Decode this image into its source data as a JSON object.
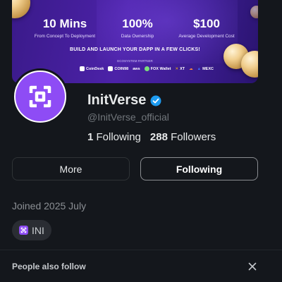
{
  "banner": {
    "stats": [
      {
        "value": "10 Mins",
        "caption": "From Concept To Deployment"
      },
      {
        "value": "100%",
        "caption": "Data Ownership"
      },
      {
        "value": "$100",
        "caption": "Average Development Cost"
      }
    ],
    "tagline": "BUILD AND LAUNCH YOUR DAPP IN A FEW CLICKS!",
    "partner_label": "ECOSYSTEM PARTNER",
    "partners": [
      "CoinDesk",
      "COIN98",
      "aws",
      "FOX Wallet",
      "XT",
      "",
      "MEXC"
    ]
  },
  "profile": {
    "name": "InitVerse",
    "handle": "@InitVerse_official",
    "following_count": "1",
    "following_label": "Following",
    "followers_count": "288",
    "followers_label": "Followers"
  },
  "actions": {
    "more_label": "More",
    "following_label": "Following"
  },
  "joined": "Joined 2025 July",
  "token_chip": {
    "label": "INI"
  },
  "suggestions": {
    "title": "People also follow"
  },
  "colors": {
    "accent": "#8e4cf5",
    "verified": "#1d9bf0",
    "background": "#14171c"
  }
}
